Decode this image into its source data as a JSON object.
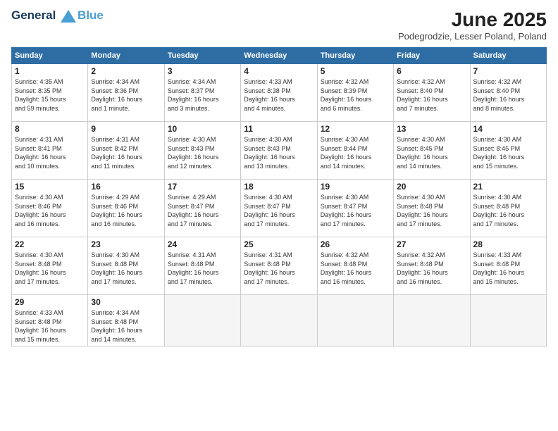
{
  "header": {
    "logo_line1": "General",
    "logo_line2": "Blue",
    "title": "June 2025",
    "location": "Podegrodzie, Lesser Poland, Poland"
  },
  "calendar": {
    "days_of_week": [
      "Sunday",
      "Monday",
      "Tuesday",
      "Wednesday",
      "Thursday",
      "Friday",
      "Saturday"
    ],
    "weeks": [
      [
        {
          "day": "1",
          "info": "Sunrise: 4:35 AM\nSunset: 8:35 PM\nDaylight: 15 hours\nand 59 minutes."
        },
        {
          "day": "2",
          "info": "Sunrise: 4:34 AM\nSunset: 8:36 PM\nDaylight: 16 hours\nand 1 minute."
        },
        {
          "day": "3",
          "info": "Sunrise: 4:34 AM\nSunset: 8:37 PM\nDaylight: 16 hours\nand 3 minutes."
        },
        {
          "day": "4",
          "info": "Sunrise: 4:33 AM\nSunset: 8:38 PM\nDaylight: 16 hours\nand 4 minutes."
        },
        {
          "day": "5",
          "info": "Sunrise: 4:32 AM\nSunset: 8:39 PM\nDaylight: 16 hours\nand 6 minutes."
        },
        {
          "day": "6",
          "info": "Sunrise: 4:32 AM\nSunset: 8:40 PM\nDaylight: 16 hours\nand 7 minutes."
        },
        {
          "day": "7",
          "info": "Sunrise: 4:32 AM\nSunset: 8:40 PM\nDaylight: 16 hours\nand 8 minutes."
        }
      ],
      [
        {
          "day": "8",
          "info": "Sunrise: 4:31 AM\nSunset: 8:41 PM\nDaylight: 16 hours\nand 10 minutes."
        },
        {
          "day": "9",
          "info": "Sunrise: 4:31 AM\nSunset: 8:42 PM\nDaylight: 16 hours\nand 11 minutes."
        },
        {
          "day": "10",
          "info": "Sunrise: 4:30 AM\nSunset: 8:43 PM\nDaylight: 16 hours\nand 12 minutes."
        },
        {
          "day": "11",
          "info": "Sunrise: 4:30 AM\nSunset: 8:43 PM\nDaylight: 16 hours\nand 13 minutes."
        },
        {
          "day": "12",
          "info": "Sunrise: 4:30 AM\nSunset: 8:44 PM\nDaylight: 16 hours\nand 14 minutes."
        },
        {
          "day": "13",
          "info": "Sunrise: 4:30 AM\nSunset: 8:45 PM\nDaylight: 16 hours\nand 14 minutes."
        },
        {
          "day": "14",
          "info": "Sunrise: 4:30 AM\nSunset: 8:45 PM\nDaylight: 16 hours\nand 15 minutes."
        }
      ],
      [
        {
          "day": "15",
          "info": "Sunrise: 4:30 AM\nSunset: 8:46 PM\nDaylight: 16 hours\nand 16 minutes."
        },
        {
          "day": "16",
          "info": "Sunrise: 4:29 AM\nSunset: 8:46 PM\nDaylight: 16 hours\nand 16 minutes."
        },
        {
          "day": "17",
          "info": "Sunrise: 4:29 AM\nSunset: 8:47 PM\nDaylight: 16 hours\nand 17 minutes."
        },
        {
          "day": "18",
          "info": "Sunrise: 4:30 AM\nSunset: 8:47 PM\nDaylight: 16 hours\nand 17 minutes."
        },
        {
          "day": "19",
          "info": "Sunrise: 4:30 AM\nSunset: 8:47 PM\nDaylight: 16 hours\nand 17 minutes."
        },
        {
          "day": "20",
          "info": "Sunrise: 4:30 AM\nSunset: 8:48 PM\nDaylight: 16 hours\nand 17 minutes."
        },
        {
          "day": "21",
          "info": "Sunrise: 4:30 AM\nSunset: 8:48 PM\nDaylight: 16 hours\nand 17 minutes."
        }
      ],
      [
        {
          "day": "22",
          "info": "Sunrise: 4:30 AM\nSunset: 8:48 PM\nDaylight: 16 hours\nand 17 minutes."
        },
        {
          "day": "23",
          "info": "Sunrise: 4:30 AM\nSunset: 8:48 PM\nDaylight: 16 hours\nand 17 minutes."
        },
        {
          "day": "24",
          "info": "Sunrise: 4:31 AM\nSunset: 8:48 PM\nDaylight: 16 hours\nand 17 minutes."
        },
        {
          "day": "25",
          "info": "Sunrise: 4:31 AM\nSunset: 8:48 PM\nDaylight: 16 hours\nand 17 minutes."
        },
        {
          "day": "26",
          "info": "Sunrise: 4:32 AM\nSunset: 8:48 PM\nDaylight: 16 hours\nand 16 minutes."
        },
        {
          "day": "27",
          "info": "Sunrise: 4:32 AM\nSunset: 8:48 PM\nDaylight: 16 hours\nand 16 minutes."
        },
        {
          "day": "28",
          "info": "Sunrise: 4:33 AM\nSunset: 8:48 PM\nDaylight: 16 hours\nand 15 minutes."
        }
      ],
      [
        {
          "day": "29",
          "info": "Sunrise: 4:33 AM\nSunset: 8:48 PM\nDaylight: 16 hours\nand 15 minutes."
        },
        {
          "day": "30",
          "info": "Sunrise: 4:34 AM\nSunset: 8:48 PM\nDaylight: 16 hours\nand 14 minutes."
        },
        {
          "day": "",
          "info": ""
        },
        {
          "day": "",
          "info": ""
        },
        {
          "day": "",
          "info": ""
        },
        {
          "day": "",
          "info": ""
        },
        {
          "day": "",
          "info": ""
        }
      ]
    ]
  }
}
